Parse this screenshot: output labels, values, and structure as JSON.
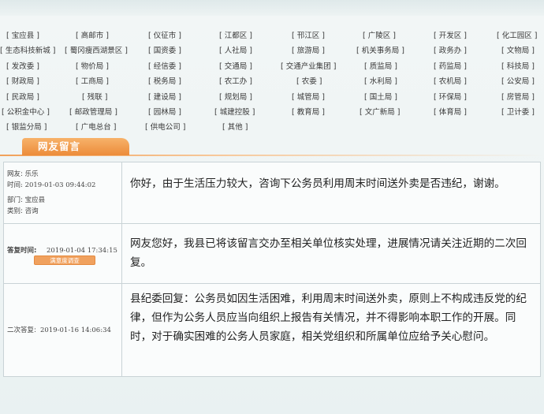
{
  "departments": {
    "rows": [
      [
        "[ 宝应县 ]",
        "[ 高邮市 ]",
        "[ 仪征市 ]",
        "[ 江都区 ]",
        "[ 邗江区 ]",
        "[ 广陵区 ]",
        "[ 开发区 ]",
        "[ 化工园区 ]"
      ],
      [
        "[ 生态科技新城 ]",
        "[ 蜀冈瘦西湖景区 ]",
        "[ 国资委 ]",
        "[ 人社局 ]",
        "[ 旅游局 ]",
        "[ 机关事务局 ]",
        "[ 政务办 ]",
        "[ 文物局 ]"
      ],
      [
        "[ 发改委 ]",
        "[ 物价局 ]",
        "[ 经信委 ]",
        "[ 交通局 ]",
        "[ 交通产业集团 ]",
        "[ 质监局 ]",
        "[ 药监局 ]",
        "[ 科技局 ]"
      ],
      [
        "[ 财政局 ]",
        "[ 工商局 ]",
        "[ 税务局 ]",
        "[ 农工办 ]",
        "[ 农委 ]",
        "[ 水利局 ]",
        "[ 农机局 ]",
        "[ 公安局 ]"
      ],
      [
        "[ 民政局 ]",
        "[ 残联 ]",
        "[ 建设局 ]",
        "[ 规划局 ]",
        "[ 城管局 ]",
        "[ 国土局 ]",
        "[ 环保局 ]",
        "[ 房管局 ]"
      ],
      [
        "[ 公积金中心 ]",
        "[ 邮政管理局 ]",
        "[ 园林局 ]",
        "[ 城建控股 ]",
        "[ 教育局 ]",
        "[ 文广新局 ]",
        "[ 体育局 ]",
        "[ 卫计委 ]"
      ],
      [
        "[ 银监分局 ]",
        "[ 广电总台 ]",
        "[ 供电公司 ]",
        "[ 其他 ]"
      ]
    ]
  },
  "section": {
    "tab_label": "网友留言"
  },
  "message": {
    "user_label": "网友: 乐乐",
    "time_label": "时间: 2019-01-03 09:44:02",
    "dept_label": "部门: 宝应县",
    "category_label": "类别: 咨询",
    "content": "你好，由于生活压力较大，咨询下公务员利用周末时间送外卖是否违纪，谢谢。"
  },
  "reply1": {
    "time_label": "答复时间:",
    "time_value": "2019-01-04 17:34:15",
    "button_label": "满意度调查",
    "content": "网友您好，我县已将该留言交办至相关单位核实处理，进展情况请关注近期的二次回复。"
  },
  "reply2": {
    "time_label": "二次答复:",
    "time_value": "2019-01-16 14:06:34",
    "content": "县纪委回复：公务员如因生活困难，利用周末时间送外卖，原则上不构成违反党的纪律，但作为公务人员应当向组织上报告有关情况，并不得影响本职工作的开展。同时，对于确实困难的公务人员家庭，相关党组织和所属单位应给予关心慰问。"
  },
  "colors": {
    "tab_orange": "#ec8c3a",
    "button_orange": "#f0a15e",
    "border": "#c9d3d6"
  }
}
